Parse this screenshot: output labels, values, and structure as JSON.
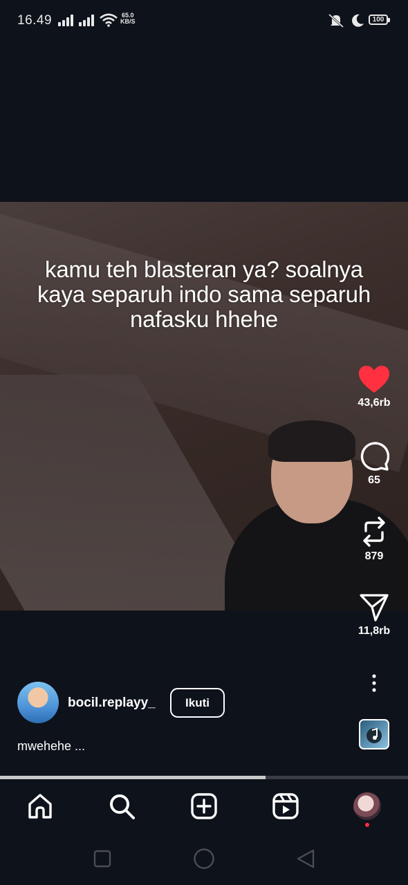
{
  "status_bar": {
    "time": "16.49",
    "net_speed_value": "65.0",
    "net_speed_unit": "KB/S",
    "battery": "100",
    "icons": [
      "signal-icon",
      "wifi-icon",
      "mute-vibrate-icon",
      "do-not-disturb-moon-icon",
      "battery-icon"
    ]
  },
  "video": {
    "caption_lines": [
      "kamu teh blasteran ya? soalnya",
      "kaya separuh indo sama separuh",
      "nafasku hhehe"
    ]
  },
  "actions": {
    "like_count": "43,6rb",
    "comment_count": "65",
    "repost_count": "879",
    "share_count": "11,8rb",
    "liked": true,
    "like_color": "#ff3040"
  },
  "post": {
    "username": "bocil.replayy_",
    "follow_label": "Ikuti",
    "description": "mwehehe ..."
  },
  "playback": {
    "progress_fraction": 0.65
  },
  "bottom_nav": {
    "items": [
      "home-icon",
      "search-icon",
      "create-icon",
      "reels-icon",
      "profile-avatar"
    ]
  }
}
